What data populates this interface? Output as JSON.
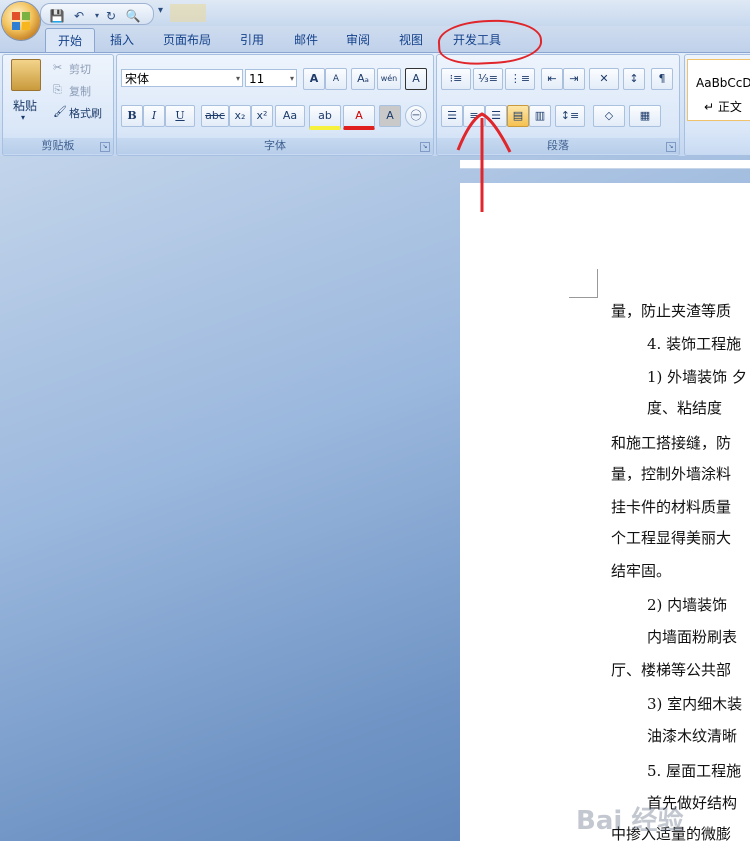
{
  "quick_access": {
    "items": [
      "save-icon",
      "undo-icon",
      "redo-icon",
      "print-preview-icon",
      "customize-icon"
    ]
  },
  "tabs": [
    "开始",
    "插入",
    "页面布局",
    "引用",
    "邮件",
    "审阅",
    "视图",
    "开发工具"
  ],
  "ribbon": {
    "clipboard": {
      "paste": "粘贴",
      "cut": "剪切",
      "copy": "复制",
      "format_painter": "格式刷",
      "label": "剪贴板"
    },
    "font": {
      "font_name": "宋体",
      "font_size": "11",
      "label": "字体",
      "buttons": [
        "B",
        "I",
        "U",
        "abc",
        "x₂",
        "x²",
        "Aa"
      ],
      "grow": "A",
      "shrink": "A",
      "wen": "wén",
      "char_border": "A",
      "highlight": "ab",
      "font_color": "A",
      "shade": "A",
      "enclose": "字"
    },
    "paragraph": {
      "label": "段落"
    },
    "styles": {
      "sample": "AaBbCcD",
      "normal": "↵ 正文"
    }
  },
  "document": {
    "lines": [
      "量，防止夹渣等质",
      "4. 装饰工程施",
      "1) 外墙装饰 夕",
      "度、粘结度",
      "和施工搭接缝，防",
      "量，控制外墙涂料",
      "挂卡件的材料质量",
      "个工程显得美丽大",
      "结牢固。",
      "2) 内墙装饰",
      "内墙面粉刷表",
      "厅、楼梯等公共部",
      "3) 室内细木装",
      "油漆木纹清晰",
      "5. 屋面工程施",
      "首先做好结构",
      "中掺入适量的微膨"
    ]
  },
  "watermark": "Bai 经验",
  "colors": {
    "annotation": "#e0262b",
    "ribbon_text": "#15428b"
  }
}
